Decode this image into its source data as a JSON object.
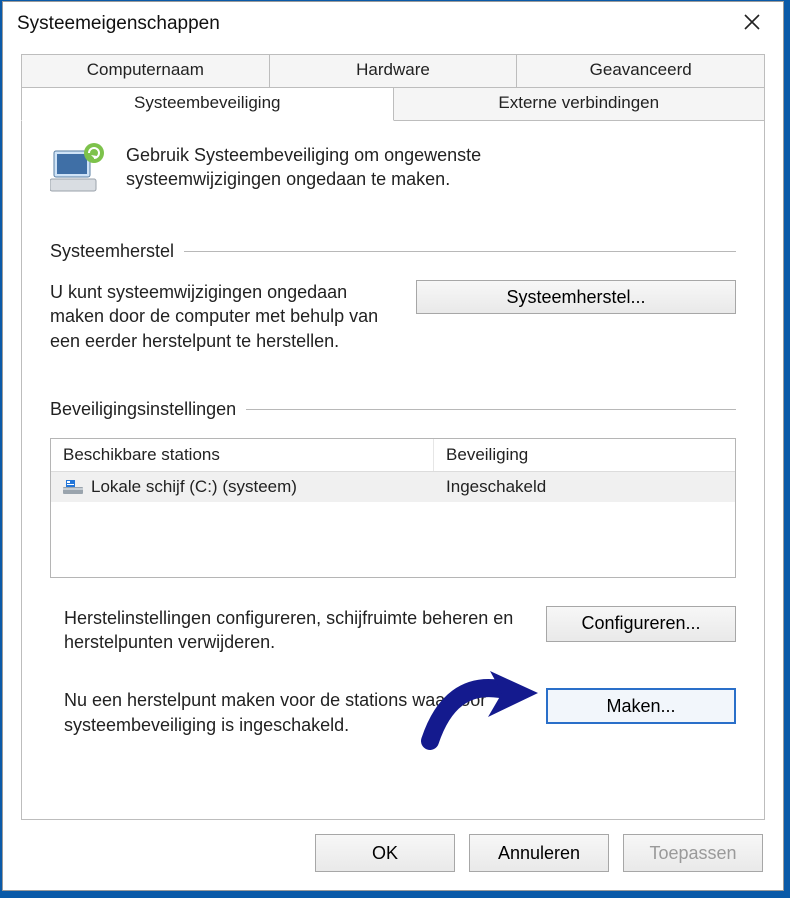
{
  "window": {
    "title": "Systeemeigenschappen"
  },
  "tabs": {
    "row1": [
      {
        "label": "Computernaam",
        "active": false
      },
      {
        "label": "Hardware",
        "active": false
      },
      {
        "label": "Geavanceerd",
        "active": false
      }
    ],
    "row2": [
      {
        "label": "Systeembeveiliging",
        "active": true
      },
      {
        "label": "Externe verbindingen",
        "active": false
      }
    ]
  },
  "intro": {
    "text": "Gebruik Systeembeveiliging om ongewenste systeemwijzigingen ongedaan te maken."
  },
  "sections": {
    "restore": {
      "heading": "Systeemherstel",
      "desc": "U kunt systeemwijzigingen ongedaan maken door de computer met behulp van een eerder herstelpunt te herstellen.",
      "button": "Systeemherstel..."
    },
    "protection": {
      "heading": "Beveiligingsinstellingen",
      "table": {
        "col_drive": "Beschikbare stations",
        "col_protection": "Beveiliging",
        "rows": [
          {
            "drive": "Lokale schijf (C:) (systeem)",
            "protection": "Ingeschakeld"
          }
        ]
      },
      "configure": {
        "desc": "Herstelinstellingen configureren, schijfruimte beheren en herstelpunten verwijderen.",
        "button": "Configureren..."
      },
      "create": {
        "desc": "Nu een herstelpunt maken voor de stations waarvoor systeembeveiliging is ingeschakeld.",
        "button": "Maken..."
      }
    }
  },
  "footer": {
    "ok": "OK",
    "cancel": "Annuleren",
    "apply": "Toepassen"
  }
}
